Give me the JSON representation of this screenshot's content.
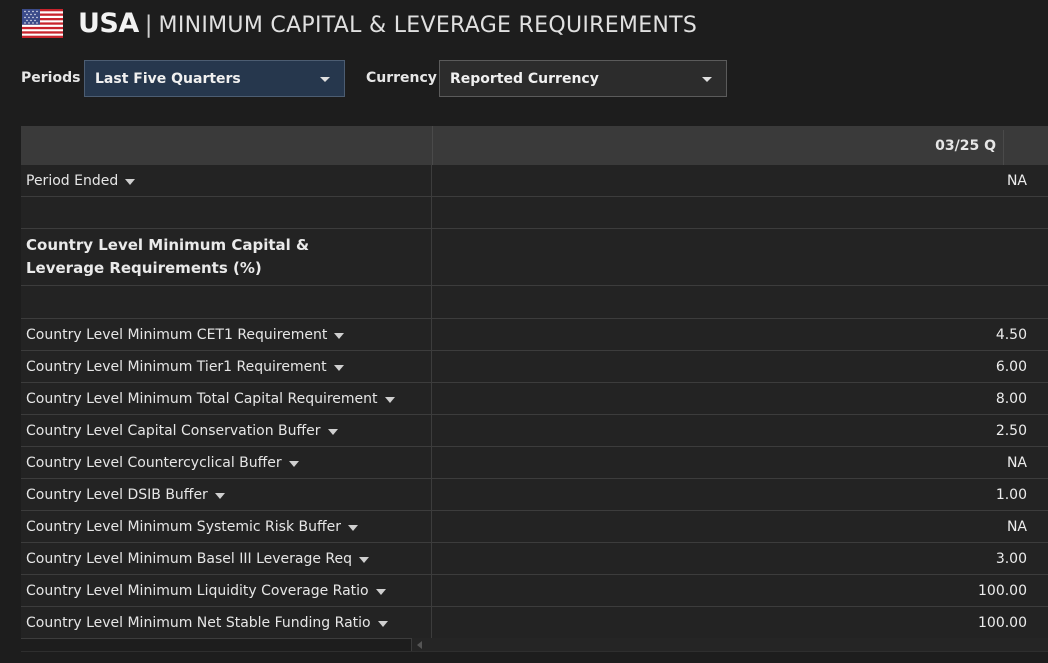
{
  "header": {
    "flag_icon": "us-flag-icon",
    "country": "USA",
    "separator": "|",
    "title": "MINIMUM CAPITAL & LEVERAGE REQUIREMENTS"
  },
  "filters": {
    "periods_label": "Periods",
    "periods_value": "Last Five Quarters",
    "currency_label": "Currency",
    "currency_value": "Reported Currency"
  },
  "colors": {
    "periods_select_bg": "#26374d",
    "background": "#1d1d1d",
    "header_row_bg": "#3a3a3a"
  },
  "table": {
    "column_header": "03/25 Q",
    "period_row": {
      "label": "Period Ended",
      "value": "NA"
    },
    "section_title": "Country Level Minimum Capital & Leverage Requirements (%)",
    "rows": [
      {
        "label": "Country Level Minimum CET1 Requirement",
        "value": "4.50"
      },
      {
        "label": "Country Level Minimum Tier1 Requirement",
        "value": "6.00"
      },
      {
        "label": "Country Level Minimum Total Capital Requirement",
        "value": "8.00"
      },
      {
        "label": "Country Level Capital Conservation Buffer",
        "value": "2.50"
      },
      {
        "label": "Country Level Countercyclical Buffer",
        "value": "NA"
      },
      {
        "label": "Country Level DSIB Buffer",
        "value": "1.00"
      },
      {
        "label": "Country Level Minimum Systemic Risk Buffer",
        "value": "NA"
      },
      {
        "label": "Country Level Minimum Basel III Leverage Req",
        "value": "3.00"
      },
      {
        "label": "Country Level Minimum Liquidity Coverage Ratio",
        "value": "100.00"
      },
      {
        "label": "Country Level Minimum Net Stable Funding Ratio",
        "value": "100.00"
      }
    ]
  }
}
